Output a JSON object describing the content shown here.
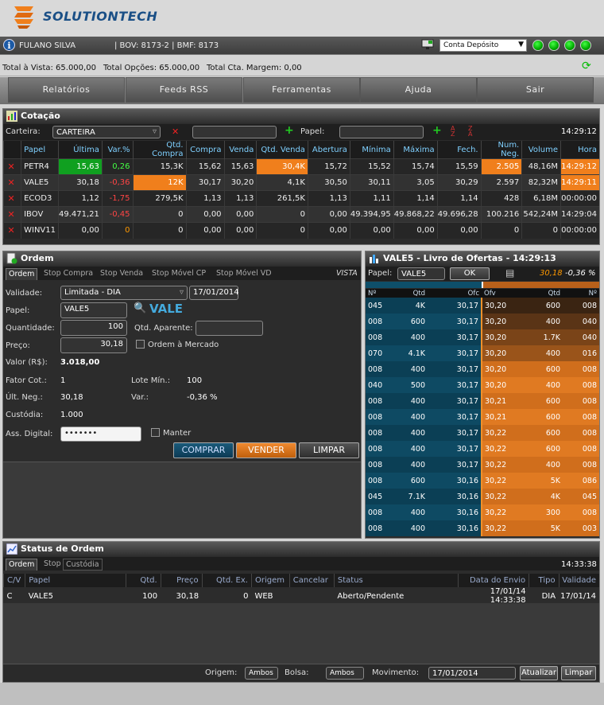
{
  "brand": {
    "name": "SOLUTIONTECH"
  },
  "user": {
    "name": "FULANO SILVA",
    "accounts": "| BOV: 8173-2 | BMF: 8173",
    "account_type": "Conta Depósito"
  },
  "totals": {
    "vista": "Total à Vista: 65.000,00",
    "opcoes": "Total Opções: 65.000,00",
    "margem": "Total Cta. Margem: 0,00"
  },
  "menu": [
    "Relatórios",
    "Feeds RSS",
    "Ferramentas",
    "Ajuda",
    "Sair"
  ],
  "cotacao": {
    "title": "Cotação",
    "carteira_label": "Carteira:",
    "carteira_value": "CARTEIRA",
    "papel_label": "Papel:",
    "time": "14:29:12",
    "headers": [
      "Papel",
      "Última",
      "Var.%",
      "Qtd. Compra",
      "Compra",
      "Venda",
      "Qtd. Venda",
      "Abertura",
      "Mínima",
      "Máxima",
      "Fech.",
      "Num. Neg.",
      "Volume",
      "Hora"
    ],
    "rows": [
      [
        "PETR4",
        "15,63",
        "0,26",
        "15,3K",
        "15,62",
        "15,63",
        "30,4K",
        "15,72",
        "15,52",
        "15,74",
        "15,59",
        "2.505",
        "48,16M",
        "14:29:12"
      ],
      [
        "VALE5",
        "30,18",
        "-0,36",
        "12K",
        "30,17",
        "30,20",
        "4,1K",
        "30,50",
        "30,11",
        "3,05",
        "30,29",
        "2.597",
        "82,32M",
        "14:29:11"
      ],
      [
        "ECOD3",
        "1,12",
        "-1,75",
        "279,5K",
        "1,13",
        "1,13",
        "261,5K",
        "1,13",
        "1,11",
        "1,14",
        "1,14",
        "428",
        "6,18M",
        "00:00:00"
      ],
      [
        "IBOV",
        "49.471,21",
        "-0,45",
        "0",
        "0,00",
        "0,00",
        "0",
        "0,00",
        "49.394,95",
        "49.868,22",
        "49.696,28",
        "100.216",
        "542,24M",
        "14:29:04"
      ],
      [
        "WINV11",
        "0,00",
        "0",
        "0",
        "0,00",
        "0,00",
        "0",
        "0,00",
        "0,00",
        "0,00",
        "0,00",
        "0",
        "0",
        "00:00:00"
      ]
    ]
  },
  "ordem": {
    "title": "Ordem",
    "tabs": [
      "Ordem",
      "Stop Compra",
      "Stop Venda",
      "Stop Móvel CP",
      "Stop Móvel VD"
    ],
    "vista": "VISTA",
    "validade_label": "Validade:",
    "validade_value": "Limitada - DIA",
    "validade_date": "17/01/2014",
    "papel_label": "Papel:",
    "papel_value": "VALE5",
    "papel_name": "VALE",
    "quantidade_label": "Quantidade:",
    "quantidade_value": "100",
    "qtd_aparente_label": "Qtd. Aparente:",
    "preco_label": "Preço:",
    "preco_value": "30,18",
    "ordem_mercado_label": "Ordem à Mercado",
    "valor_label": "Valor (R$):",
    "valor_value": "3.018,00",
    "fator_label": "Fator Cot.:",
    "fator_value": "1",
    "lote_label": "Lote Mín.:",
    "lote_value": "100",
    "ult_label": "Últ. Neg.:",
    "ult_value": "30,18",
    "var_label": "Var.:",
    "var_value": "-0,36 %",
    "custodia_label": "Custódia:",
    "custodia_value": "1.000",
    "ass_label": "Ass. Digital:",
    "ass_value": "•••••••",
    "manter_label": "Manter",
    "buttons": {
      "comprar": "COMPRAR",
      "vender": "VENDER",
      "limpar": "LIMPAR"
    }
  },
  "livro": {
    "title": "VALE5 - Livro de Ofertas - 14:29:13",
    "papel_label": "Papel:",
    "papel_value": "VALE5",
    "ok": "OK",
    "price": "30,18",
    "var": "-0,36 %",
    "headers": [
      "Nº",
      "Qtd",
      "Ofc",
      "Ofv",
      "Qtd",
      "Nº"
    ],
    "rows": [
      [
        "045",
        "4K",
        "30,17",
        "30,20",
        "600",
        "008"
      ],
      [
        "008",
        "600",
        "30,17",
        "30,20",
        "400",
        "040"
      ],
      [
        "008",
        "400",
        "30,17",
        "30,20",
        "1.7K",
        "040"
      ],
      [
        "070",
        "4.1K",
        "30,17",
        "30,20",
        "400",
        "016"
      ],
      [
        "008",
        "400",
        "30,17",
        "30,20",
        "600",
        "008"
      ],
      [
        "040",
        "500",
        "30,17",
        "30,20",
        "400",
        "008"
      ],
      [
        "008",
        "400",
        "30,17",
        "30,21",
        "600",
        "008"
      ],
      [
        "008",
        "400",
        "30,17",
        "30,21",
        "600",
        "008"
      ],
      [
        "008",
        "400",
        "30,17",
        "30,22",
        "600",
        "008"
      ],
      [
        "008",
        "400",
        "30,17",
        "30,22",
        "600",
        "008"
      ],
      [
        "008",
        "400",
        "30,17",
        "30,22",
        "400",
        "008"
      ],
      [
        "008",
        "600",
        "30,16",
        "30,22",
        "5K",
        "086"
      ],
      [
        "045",
        "7.1K",
        "30,16",
        "30,22",
        "4K",
        "045"
      ],
      [
        "008",
        "400",
        "30,16",
        "30,22",
        "300",
        "008"
      ],
      [
        "008",
        "400",
        "30,16",
        "30,22",
        "5K",
        "003"
      ]
    ]
  },
  "status": {
    "title": "Status de Ordem",
    "tabs": [
      "Ordem",
      "Stop",
      "Custódia"
    ],
    "time": "14:33:38",
    "headers": [
      "C/V",
      "Papel",
      "Qtd.",
      "Preço",
      "Qtd. Ex.",
      "Origem",
      "Cancelar",
      "Status",
      "Data do Envio",
      "Tipo",
      "Validade"
    ],
    "rows": [
      [
        "C",
        "VALE5",
        "100",
        "30,18",
        "0",
        "WEB",
        "",
        "Aberto/Pendente",
        "17/01/14 14:33:38",
        "DIA",
        "17/01/14"
      ]
    ],
    "filter": {
      "origem_label": "Origem:",
      "origem_value": "Ambos",
      "bolsa_label": "Bolsa:",
      "bolsa_value": "Ambos",
      "movimento_label": "Movimento:",
      "movimento_value": "17/01/2014",
      "atualizar": "Atualizar",
      "limpar": "Limpar"
    }
  },
  "colors": {
    "accent_orange": "#f07f1c",
    "buy_blue": "#0e4f6a",
    "sell_orange": "#d9731c",
    "up_green": "#10a020"
  }
}
